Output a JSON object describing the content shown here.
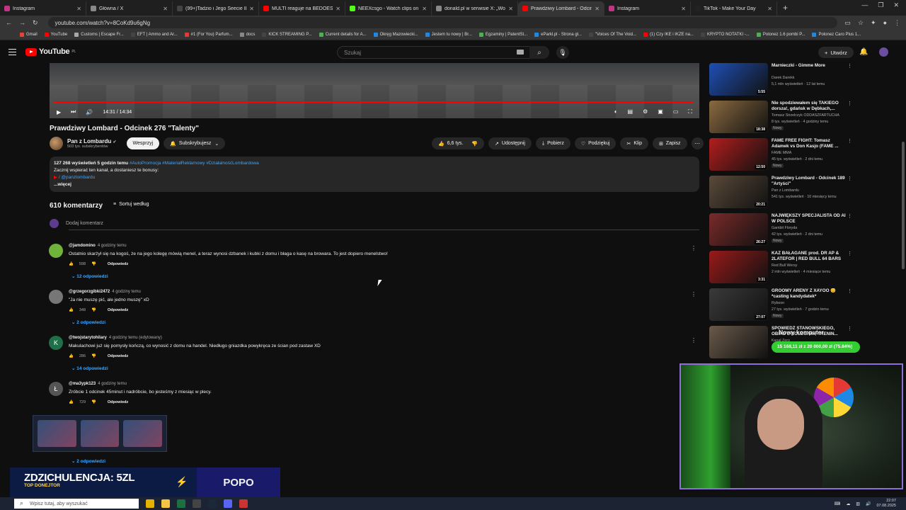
{
  "tabs": [
    {
      "label": "Instagram",
      "color": "#c13584"
    },
    {
      "label": "Główna / X",
      "color": "#888888"
    },
    {
      "label": "(99+)Tadzio i Jego Seecie Ibiza",
      "color": "#444444"
    },
    {
      "label": "MULTI reaguje na BEDOES - HI",
      "color": "#ff0000"
    },
    {
      "label": "NEEXcsgo - Watch clips on Kick",
      "color": "#53fc18"
    },
    {
      "label": "donald.pl w serwisie X: „Wola",
      "color": "#888888"
    },
    {
      "label": "Prawdziwy Lombard - Odcinek",
      "color": "#ff0000"
    },
    {
      "label": "Instagram",
      "color": "#c13584"
    },
    {
      "label": "TikTok - Make Your Day",
      "color": "#222222"
    }
  ],
  "address": {
    "url": "youtube.com/watch?v=8CoKd9u6gNg"
  },
  "bookmarks": [
    {
      "label": "Gmail",
      "color": "#ea4335"
    },
    {
      "label": "YouTube",
      "color": "#ff0000"
    },
    {
      "label": "Customs | Escape Fr...",
      "color": "#aaaaaa"
    },
    {
      "label": "EFT | Ammo and Ar...",
      "color": "#444444"
    },
    {
      "label": "#1 (For You) Parfum...",
      "color": "#e53935"
    },
    {
      "label": "docs",
      "color": "#888888"
    },
    {
      "label": "KICK STREAMING P...",
      "color": "#444444"
    },
    {
      "label": "Current details for A...",
      "color": "#4caf50"
    },
    {
      "label": "Okręg Mazowiecki...",
      "color": "#1e88e5"
    },
    {
      "label": "Jestem tu nowy | Br...",
      "color": "#1e88e5"
    },
    {
      "label": "Egzaminy | PatentSt...",
      "color": "#4caf50"
    },
    {
      "label": "eParkl.pl - Strona gł...",
      "color": "#1e88e5"
    },
    {
      "label": "\"Voices Of The Void...",
      "color": "#444444"
    },
    {
      "label": "(1) Czy IKE i IKZE na...",
      "color": "#ff0000"
    },
    {
      "label": "KRYPTO NOTATKI -...",
      "color": "#444444"
    },
    {
      "label": "Polonez 1.6 pombi P...",
      "color": "#4caf50"
    },
    {
      "label": "Polonez Caro Plus 1...",
      "color": "#1e88e5"
    }
  ],
  "yt": {
    "logo": "YouTube",
    "region": "PL",
    "search_placeholder": "Szukaj",
    "create_label": "Utwórz"
  },
  "player": {
    "time": "14:31 / 14:34",
    "progress": 0.997
  },
  "video": {
    "title": "Prawdziwy Lombard - Odcinek 276 \"Talenty\"",
    "channel": "Pan z Lombardu",
    "subs": "503 tys. subskrybentów",
    "support_label": "Wesprzyj",
    "subscribed_label": "Subskrybujesz",
    "likes": "6,6 tys.",
    "share_label": "Udostępnij",
    "download_label": "Pobierz",
    "thanks_label": "Podziękuj",
    "clip_label": "Klip",
    "save_label": "Zapisz"
  },
  "description": {
    "meta": "127 268 wyświetleń  5 godzin temu",
    "tags": "#AutoPromocja #MateriałReklamowy #DziałalnośćLombardowa",
    "line1": "Zacznij wspierać ten kanał, a dostaniesz te bonusy:",
    "line2": "/ @panzlombardu",
    "more": "...więcej"
  },
  "comments_header": {
    "count": "610 komentarzy",
    "sort_label": "Sortuj według",
    "add_placeholder": "Dodaj komentarz"
  },
  "comments": [
    {
      "author": "@jamdomino",
      "time": "4 godziny temu",
      "text": "Ostatnio skarżył się na kogoś, że na jego kolegę mówią menel, a teraz wynosi dzbanek i kubki z domu i błaga o kasę na browara. To jest dopiero menelstwo!",
      "likes": "598",
      "reply_label": "Odpowiedz",
      "replies": "12 odpowiedzi",
      "initial": "",
      "color": "#6fb33a"
    },
    {
      "author": "@grzegorzgibki2472",
      "time": "4 godziny temu",
      "text": "\"Ja nie muszę pić, ale jedno muszę\" xD",
      "likes": "348",
      "reply_label": "Odpowiedz",
      "replies": "2 odpowiedzi",
      "initial": "",
      "color": "#777777"
    },
    {
      "author": "@twojstarytohilary",
      "time": "4 godziny temu (edytowany)",
      "text": "Makulachowi już się pomysły kończą, co wynosić z domu na handel. Niedługo gniazdka powykręca ze ścian pod zastaw XD",
      "likes": "286",
      "reply_label": "Odpowiedz",
      "replies": "14 odpowiedzi",
      "initial": "K",
      "color": "#1f6f4a"
    },
    {
      "author": "@ma3ypk123",
      "time": "4 godziny temu",
      "text": "Zróbcie 1 odcinek 45minut i nadróbcie, bo jesteśmy z miesiąc w plecy.",
      "likes": "729",
      "reply_label": "Odpowiedz",
      "replies": "2 odpowiedzi",
      "initial": "Ł",
      "color": "#555555"
    }
  ],
  "sidebar": [
    {
      "title": "Marnieczki - Gimme More",
      "channel": "Darek Darekk",
      "views": "5,1 mln wyświetleń · 12 lat temu",
      "duration": "5:55",
      "new": "",
      "thumb": "#1e4fb5"
    },
    {
      "title": "Nie spodziewałem się TAKIEGO dorsza!, gdańsk w Dębkach,...",
      "channel": "Tomasz Strzelczyk ODDASZFARTUCHA",
      "views": "8 tys. wyświetleń · 4 godziny temu",
      "duration": "18:38",
      "new": "Nowy",
      "thumb": "#8a6a40"
    },
    {
      "title": "FAME FREE FIGHT: Tomasz Adamek vs Don Kasjo (FAME ...",
      "channel": "FAME MMA",
      "views": "45 tys. wyświetleń · 2 dni temu",
      "duration": "12:50",
      "new": "Nowy",
      "thumb": "#b31d1d"
    },
    {
      "title": "Prawdziwy Lombard - Odcinek 189 \"Artyści\"",
      "channel": "Pan z Lombardu",
      "views": "541 tys. wyświetleń · 10 miesięcy temu",
      "duration": "20:21",
      "new": "",
      "thumb": "#5a4a3a"
    },
    {
      "title": "NAJWIĘKSZY SPECJALISTA OD AI W POLSCE",
      "channel": "Gambit Floryda",
      "views": "42 tys. wyświetleń · 2 dni temu",
      "duration": "26:27",
      "new": "Nowy",
      "thumb": "#7a2a2a"
    },
    {
      "title": "KAZ BAŁAGANE prod. DR AP & 2LATEFOR | RED BULL 64 BARS",
      "channel": "Red Bull Wersy",
      "views": "2 mln wyświetleń · 4 miesiące temu",
      "duration": "3:31",
      "new": "",
      "thumb": "#9a1a1a"
    },
    {
      "title": "GROOMY ARENY Z XAYOO 😊 *casting kandydatek*",
      "channel": "Ryboon",
      "views": "27 tys. wyświetleń · 7 godzin temu",
      "duration": "27:07",
      "new": "Nowy",
      "thumb": "#3a3a3a"
    },
    {
      "title": "SPOWIEDŹ STANOWSKIEGO, OBIAD Z KOLEGAMI, TRENIN...",
      "channel": "Kanał Zero",
      "views": "",
      "duration": "",
      "new": "",
      "thumb": "#6a5a4a"
    }
  ],
  "overlays": {
    "donate_title": "Nowy komputer",
    "donate_progress": "15 168,11 zł z 20 000,00 zł (75.84%)",
    "top_donor": "ZDZICHULENCJA: 5ZL",
    "top_donor_label": "TOP DONEJTOR",
    "popo": "POPO"
  },
  "taskbar": {
    "search_placeholder": "Wpisz tutaj, aby wyszukać",
    "time": "22:07",
    "date": "07.08.2025"
  }
}
